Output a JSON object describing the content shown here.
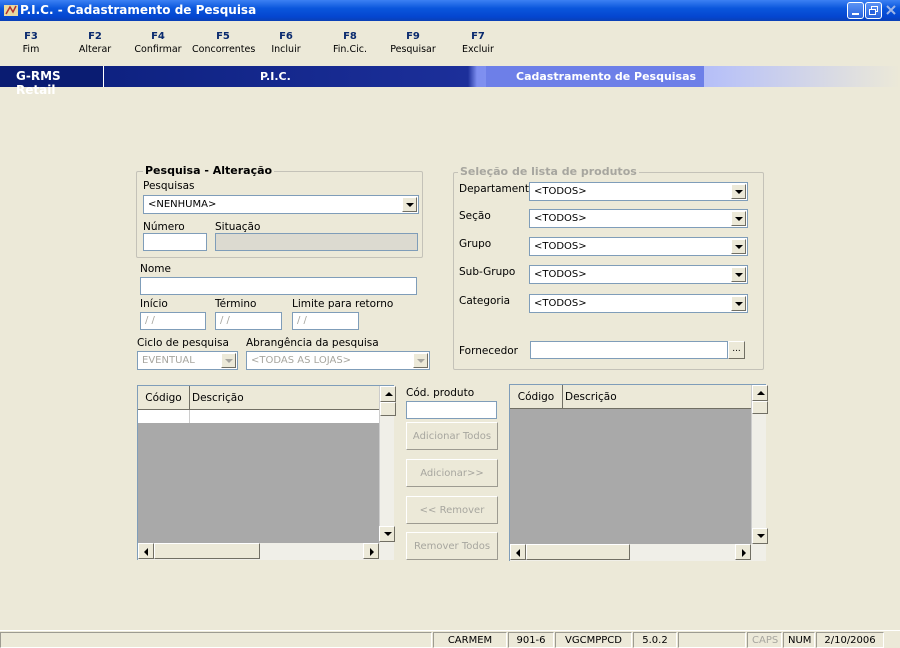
{
  "window": {
    "title": "P.I.C. - Cadastramento de Pesquisa"
  },
  "toolbar": [
    {
      "key": "F3",
      "label": "Fim"
    },
    {
      "key": "F2",
      "label": "Alterar"
    },
    {
      "key": "F4",
      "label": "Confirmar"
    },
    {
      "key": "F5",
      "label": "Concorrentes"
    },
    {
      "key": "F6",
      "label": "Incluir"
    },
    {
      "key": "F8",
      "label": "Fin.Cic."
    },
    {
      "key": "F9",
      "label": "Pesquisar"
    },
    {
      "key": "F7",
      "label": "Excluir"
    }
  ],
  "band": {
    "left": "G-RMS Retail",
    "middle": "P.I.C.",
    "right": "Cadastramento de Pesquisas"
  },
  "pesquisa": {
    "legend": "Pesquisa - Alteração",
    "pesquisas_label": "Pesquisas",
    "pesquisas_value": "<NENHUMA>",
    "numero_label": "Número",
    "numero_value": "",
    "situacao_label": "Situação",
    "situacao_value": ""
  },
  "details": {
    "nome_label": "Nome",
    "nome_value": "",
    "inicio_label": "Início",
    "inicio_value": "/ /",
    "termino_label": "Término",
    "termino_value": "/ /",
    "limite_label": "Limite para retorno",
    "limite_value": "/ /",
    "ciclo_label": "Ciclo de pesquisa",
    "ciclo_value": "EVENTUAL",
    "abrangencia_label": "Abrangência da pesquisa",
    "abrangencia_value": "<TODAS AS LOJAS>"
  },
  "selecao": {
    "legend": "Seleção de lista de produtos",
    "departamento_label": "Departamento",
    "departamento_value": "<TODOS>",
    "secao_label": "Seção",
    "secao_value": "<TODOS>",
    "grupo_label": "Grupo",
    "grupo_value": "<TODOS>",
    "subgrupo_label": "Sub-Grupo",
    "subgrupo_value": "<TODOS>",
    "categoria_label": "Categoria",
    "categoria_value": "<TODOS>",
    "fornecedor_label": "Fornecedor",
    "fornecedor_value": "",
    "fornecedor_button": "..."
  },
  "left_grid": {
    "columns": [
      "Código",
      "Descrição"
    ]
  },
  "right_grid": {
    "columns": [
      "Código",
      "Descrição"
    ]
  },
  "middle": {
    "cod_produto_label": "Cód. produto",
    "cod_produto_value": "",
    "adicionar_todos": "Adicionar Todos",
    "adicionar": "Adicionar>>",
    "remover": "<< Remover",
    "remover_todos": "Remover Todos"
  },
  "statusbar": {
    "user": "CARMEM",
    "code": "901-6",
    "program": "VGCMPPCD",
    "version": "5.0.2",
    "caps": "CAPS",
    "num": "NUM",
    "date": "2/10/2006"
  },
  "colors": {
    "titlebar": "#0a56dc",
    "band_dark": "#0a1c72",
    "band_light": "#6d7fe8",
    "window_bg": "#ece9d8",
    "grid_bg": "#a9a9a9"
  }
}
